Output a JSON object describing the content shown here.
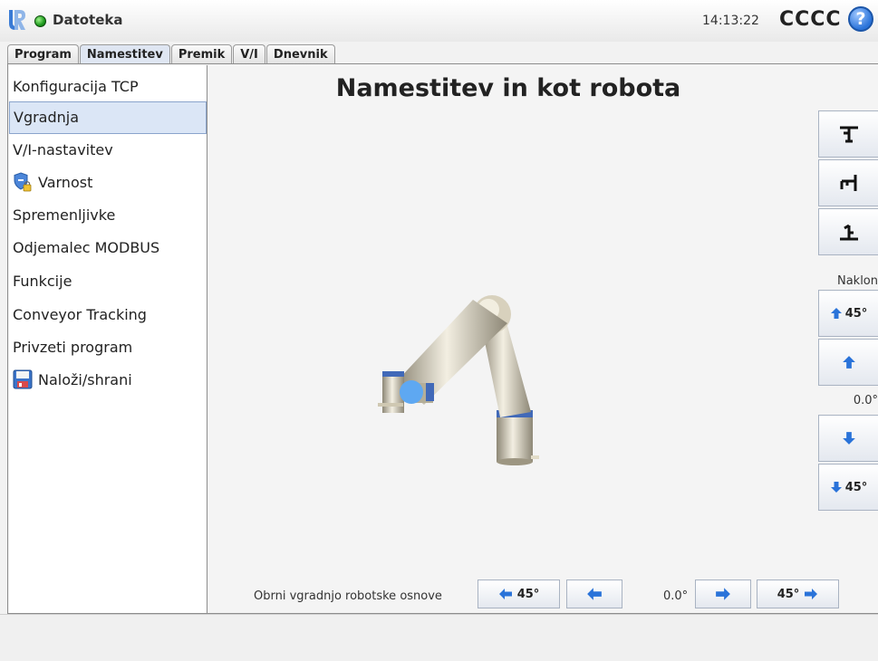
{
  "header": {
    "title": "Datoteka",
    "clock": "14:13:22",
    "robot_name": "CCCC",
    "help": "?"
  },
  "tabs": [
    {
      "label": "Program"
    },
    {
      "label": "Namestitev",
      "active": true
    },
    {
      "label": "Premik"
    },
    {
      "label": "V/I"
    },
    {
      "label": "Dnevnik"
    }
  ],
  "sidebar": {
    "items": [
      {
        "label": "Konfiguracija TCP"
      },
      {
        "label": "Vgradnja",
        "active": true
      },
      {
        "label": "V/I-nastavitev"
      },
      {
        "label": "Varnost",
        "icon": "shield-lock-icon"
      },
      {
        "label": "Spremenljivke"
      },
      {
        "label": "Odjemalec MODBUS"
      },
      {
        "label": "Funkcije"
      },
      {
        "label": "Conveyor Tracking"
      },
      {
        "label": "Privzeti program"
      },
      {
        "label": "Naloži/shrani",
        "icon": "floppy-disk-icon"
      }
    ]
  },
  "main": {
    "title": "Namestitev in kot robota"
  },
  "right_panel": {
    "mount_buttons": [
      {
        "icon": "mount-ceiling-icon"
      },
      {
        "icon": "mount-wall-icon"
      },
      {
        "icon": "mount-floor-icon"
      }
    ],
    "tilt_label": "Naklon",
    "tilt_up_45": "45°",
    "tilt_value": "0.0°",
    "tilt_down_45": "45°"
  },
  "bottom": {
    "rotate_label": "Obrni vgradnjo robotske osnove",
    "left_45": "45°",
    "rotation_value": "0.0°",
    "right_45": "45°"
  },
  "colors": {
    "accent": "#2a73d9",
    "active_bg": "#dbe6f6",
    "robot_joint_ring": "#3f72c9"
  }
}
